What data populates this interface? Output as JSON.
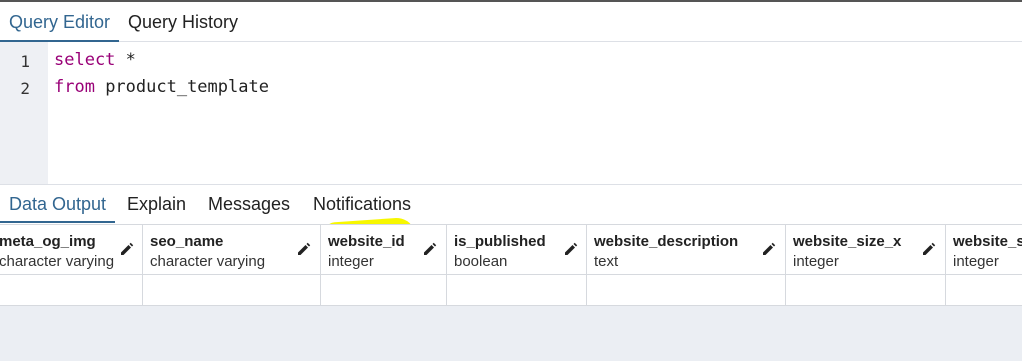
{
  "query_tabs": [
    {
      "label": "Query Editor",
      "active": true
    },
    {
      "label": "Query History",
      "active": false
    }
  ],
  "editor": {
    "lines": [
      {
        "num": "1",
        "keyword": "select",
        "rest": " *"
      },
      {
        "num": "2",
        "keyword": "from",
        "rest": " product_template"
      }
    ]
  },
  "output_tabs": [
    {
      "label": "Data Output",
      "active": true
    },
    {
      "label": "Explain",
      "active": false
    },
    {
      "label": "Messages",
      "active": false
    },
    {
      "label": "Notifications",
      "active": false
    }
  ],
  "columns": [
    {
      "name": "meta_og_img",
      "type": "character varying",
      "highlighted": false
    },
    {
      "name": "seo_name",
      "type": "character varying",
      "highlighted": false
    },
    {
      "name": "website_id",
      "type": "integer",
      "highlighted": true
    },
    {
      "name": "is_published",
      "type": "boolean",
      "highlighted": false
    },
    {
      "name": "website_description",
      "type": "text",
      "highlighted": false
    },
    {
      "name": "website_size_x",
      "type": "integer",
      "highlighted": false
    },
    {
      "name": "website_size_y",
      "type": "integer",
      "highlighted": false
    }
  ],
  "colors": {
    "accent": "#326690",
    "keyword": "#990077",
    "highlight": "#f7f700"
  },
  "icons": {
    "edit": "pencil-icon"
  }
}
